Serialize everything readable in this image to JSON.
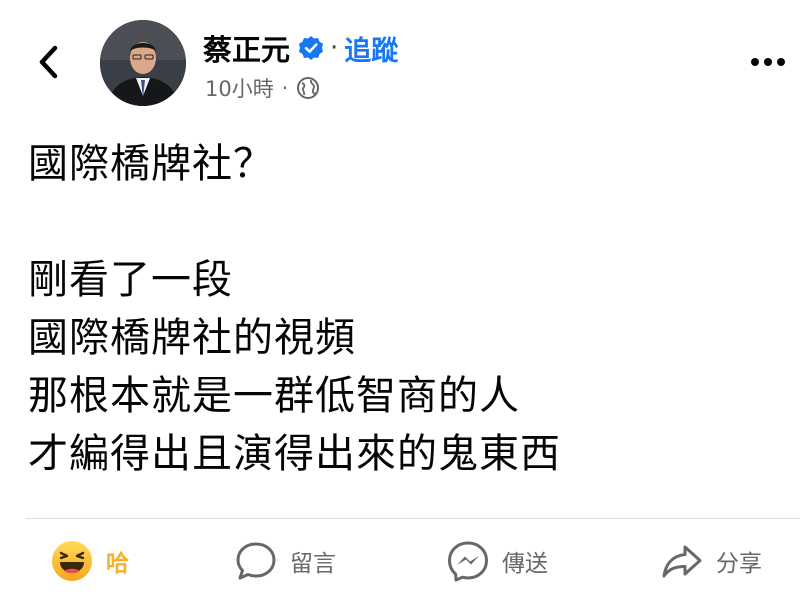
{
  "header": {
    "author_name": "蔡正元",
    "separator": "·",
    "follow_label": "追蹤",
    "timestamp": "10小時",
    "meta_separator": "·",
    "icons": {
      "back": "chevron-left-icon",
      "verified": "verified-badge-icon",
      "privacy": "globe-icon",
      "more": "more-horizontal-icon"
    }
  },
  "post": {
    "lines": [
      "國際橋牌社？",
      "",
      "剛看了一段",
      "國際橋牌社的視頻",
      "那根本就是一群低智商的人",
      "才編得出且演得出來的鬼東西"
    ]
  },
  "actions": {
    "reaction": {
      "label": "哈",
      "icon": "haha-emoji-icon"
    },
    "comment": {
      "label": "留言",
      "icon": "comment-bubble-icon"
    },
    "send": {
      "label": "傳送",
      "icon": "messenger-icon"
    },
    "share": {
      "label": "分享",
      "icon": "share-arrow-icon"
    }
  },
  "colors": {
    "accent": "#1877f2",
    "haha": "#f7b125",
    "muted": "#65676b",
    "divider": "#dadde1"
  }
}
